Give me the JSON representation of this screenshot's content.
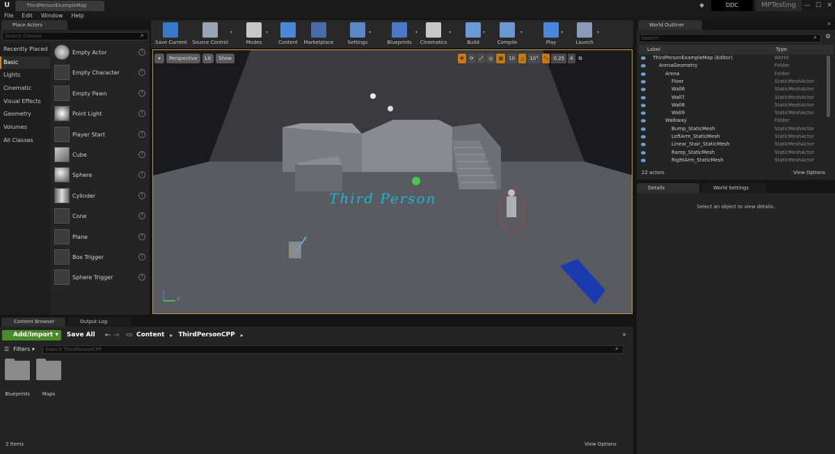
{
  "titlebar": {
    "doc_tab": "ThirdPersonExampleMap",
    "ddc": "DDC",
    "project": "MPTesting",
    "controls": [
      "—",
      "☐",
      "✕"
    ]
  },
  "menu": [
    "File",
    "Edit",
    "Window",
    "Help"
  ],
  "place_actors": {
    "tab": "Place Actors",
    "search_placeholder": "Search Classes",
    "categories": [
      "Recently Placed",
      "Basic",
      "Lights",
      "Cinematic",
      "Visual Effects",
      "Geometry",
      "Volumes",
      "All Classes"
    ],
    "actors": [
      "Empty Actor",
      "Empty Character",
      "Empty Pawn",
      "Point Light",
      "Player Start",
      "Cube",
      "Sphere",
      "Cylinder",
      "Cone",
      "Plane",
      "Box Trigger",
      "Sphere Trigger"
    ]
  },
  "toolbar": {
    "items": [
      {
        "label": "Save Current",
        "color": "#3a78c8",
        "arrow": false
      },
      {
        "label": "Source Control",
        "color": "#9aa4b4",
        "arrow": true
      },
      {
        "label": "Modes",
        "color": "#c8c8c8",
        "arrow": true
      },
      {
        "label": "Content",
        "color": "#4a88d8",
        "arrow": false
      },
      {
        "label": "Marketplace",
        "color": "#4a6aa8",
        "arrow": false
      },
      {
        "label": "Settings",
        "color": "#5a88c8",
        "arrow": true
      },
      {
        "label": "Blueprints",
        "color": "#4a78c8",
        "arrow": true
      },
      {
        "label": "Cinematics",
        "color": "#c8c8c8",
        "arrow": true
      },
      {
        "label": "Build",
        "color": "#6a9ad8",
        "arrow": true
      },
      {
        "label": "Compile",
        "color": "#6a98d0",
        "arrow": true
      },
      {
        "label": "Play",
        "color": "#4a88e0",
        "arrow": true
      },
      {
        "label": "Launch",
        "color": "#8a9ab8",
        "arrow": true
      }
    ]
  },
  "viewport": {
    "perspective": "Perspective",
    "lit": "Lit",
    "show": "Show",
    "grid_snap": "10",
    "rot_snap": "10°",
    "scale_snap": "0.25",
    "camera_speed": "4",
    "world_text": "Third Person",
    "axis_y": "Y"
  },
  "world_outliner": {
    "tab": "World Outliner",
    "search_placeholder": "Search",
    "col_label": "Label",
    "col_type": "Type",
    "rows": [
      {
        "label": "ThirdPersonExampleMap (Editor)",
        "type": "World",
        "indent": 0
      },
      {
        "label": "ArenaGeometry",
        "type": "Folder",
        "indent": 1
      },
      {
        "label": "Arena",
        "type": "Folder",
        "indent": 2
      },
      {
        "label": "Floor",
        "type": "StaticMeshActor",
        "indent": 3
      },
      {
        "label": "Wall6",
        "type": "StaticMeshActor",
        "indent": 3
      },
      {
        "label": "Wall7",
        "type": "StaticMeshActor",
        "indent": 3
      },
      {
        "label": "Wall8",
        "type": "StaticMeshActor",
        "indent": 3
      },
      {
        "label": "Wall9",
        "type": "StaticMeshActor",
        "indent": 3
      },
      {
        "label": "Walkway",
        "type": "Folder",
        "indent": 2
      },
      {
        "label": "Bump_StaticMesh",
        "type": "StaticMeshActor",
        "indent": 3
      },
      {
        "label": "LeftArm_StaticMesh",
        "type": "StaticMeshActor",
        "indent": 3
      },
      {
        "label": "Linear_Stair_StaticMesh",
        "type": "StaticMeshActor",
        "indent": 3
      },
      {
        "label": "Ramp_StaticMesh",
        "type": "StaticMeshActor",
        "indent": 3
      },
      {
        "label": "RightArm_StaticMesh",
        "type": "StaticMeshActor",
        "indent": 3
      }
    ],
    "actor_count": "22 actors",
    "view_options": "View Options"
  },
  "details": {
    "tab": "Details",
    "tab2": "World Settings",
    "message": "Select an object to view details."
  },
  "content_browser": {
    "tab": "Content Browser",
    "tab2": "Output Log",
    "add_import": "Add/Import",
    "save_all": "Save All",
    "path": [
      "Content",
      "ThirdPersonCPP"
    ],
    "filters": "Filters",
    "search_placeholder": "Search ThirdPersonCPP",
    "folders": [
      "Blueprints",
      "Maps"
    ],
    "item_count": "2 items",
    "view_options": "View Options"
  }
}
